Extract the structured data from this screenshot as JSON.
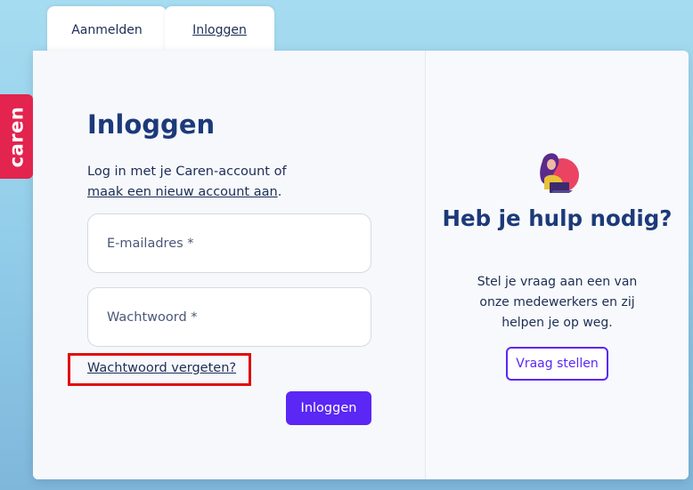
{
  "tabs": [
    {
      "label": "Aanmelden",
      "active": false
    },
    {
      "label": "Inloggen",
      "active": true
    }
  ],
  "brand": {
    "name": "caren"
  },
  "login": {
    "title": "Inloggen",
    "intro_text": "Log in met je Caren-account of",
    "intro_link": "maak een nieuw account aan",
    "intro_suffix": ".",
    "email_placeholder": "E-mailadres *",
    "password_placeholder": "Wachtwoord *",
    "forgot_link": "Wachtwoord vergeten?",
    "submit_label": "Inloggen"
  },
  "help": {
    "icon": "person-with-laptop-icon",
    "title": "Heb je hulp nodig?",
    "text": "Stel je vraag aan een van onze medewerkers en zij helpen je op weg.",
    "button_label": "Vraag stellen"
  },
  "colors": {
    "primary": "#5a27f5",
    "heading": "#1c3a7a",
    "brand": "#e2244e",
    "highlight": "#e00d0d"
  }
}
